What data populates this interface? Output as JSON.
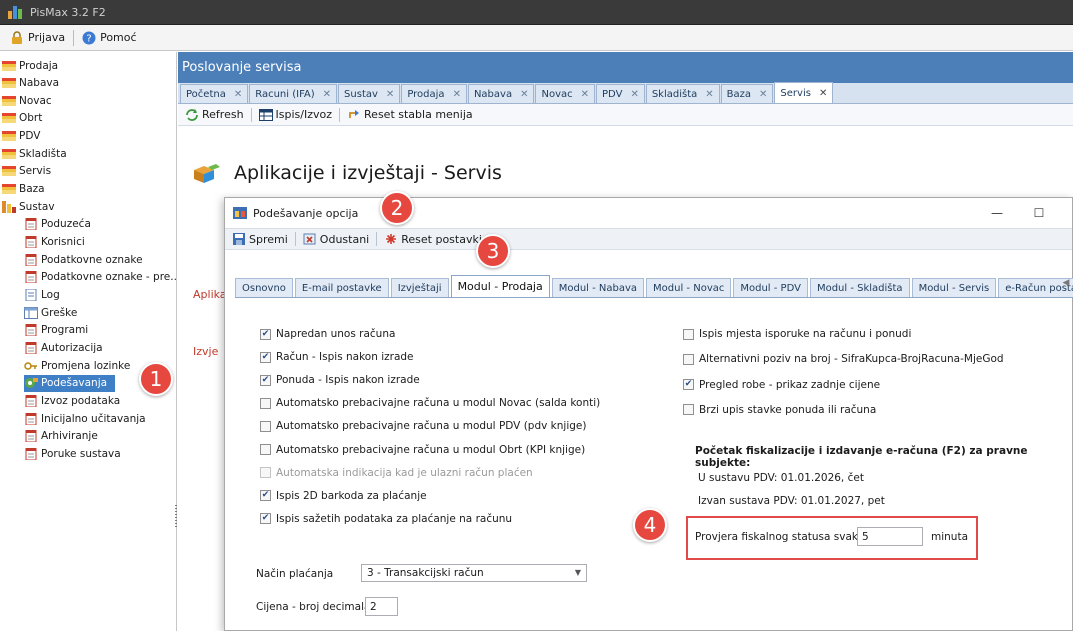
{
  "window": {
    "title": "PisMax 3.2 F2"
  },
  "menubar": {
    "items": [
      "Prijava",
      "Pomoć"
    ]
  },
  "tree": {
    "items": [
      {
        "label": "Prodaja",
        "level": 0,
        "icon": "folder-flag-icon"
      },
      {
        "label": "Nabava",
        "level": 0,
        "icon": "folder-flag-icon"
      },
      {
        "label": "Novac",
        "level": 0,
        "icon": "folder-flag-icon"
      },
      {
        "label": "Obrt",
        "level": 0,
        "icon": "folder-flag-icon"
      },
      {
        "label": "PDV",
        "level": 0,
        "icon": "folder-flag-icon"
      },
      {
        "label": "Skladišta",
        "level": 0,
        "icon": "folder-flag-icon"
      },
      {
        "label": "Servis",
        "level": 0,
        "icon": "folder-flag-icon"
      },
      {
        "label": "Baza",
        "level": 0,
        "icon": "folder-flag-icon"
      },
      {
        "label": "Sustav",
        "level": 0,
        "icon": "system-icon"
      },
      {
        "label": "Poduzeća",
        "level": 1,
        "icon": "document-icon"
      },
      {
        "label": "Korisnici",
        "level": 1,
        "icon": "document-icon"
      },
      {
        "label": "Podatkovne oznake",
        "level": 1,
        "icon": "document-icon"
      },
      {
        "label": "Podatkovne oznake - pre...",
        "level": 1,
        "icon": "document-icon"
      },
      {
        "label": "Log",
        "level": 1,
        "icon": "log-icon"
      },
      {
        "label": "Greške",
        "level": 1,
        "icon": "table-icon"
      },
      {
        "label": "Programi",
        "level": 1,
        "icon": "document-icon"
      },
      {
        "label": "Autorizacija",
        "level": 1,
        "icon": "document-icon"
      },
      {
        "label": "Promjena lozinke",
        "level": 1,
        "icon": "key-icon"
      },
      {
        "label": "Podešavanja",
        "level": 1,
        "icon": "settings-icon",
        "selected": true
      },
      {
        "label": "Izvoz podataka",
        "level": 1,
        "icon": "document-icon"
      },
      {
        "label": "Inicijalno učitavanja",
        "level": 1,
        "icon": "document-icon"
      },
      {
        "label": "Arhiviranje",
        "level": 1,
        "icon": "document-icon"
      },
      {
        "label": "Poruke sustava",
        "level": 1,
        "icon": "document-icon"
      }
    ]
  },
  "main": {
    "header": "Poslovanje servisa",
    "tabs": [
      "Početna",
      "Racuni (IFA)",
      "Sustav",
      "Prodaja",
      "Nabava",
      "Novac",
      "PDV",
      "Skladišta",
      "Baza",
      "Servis"
    ],
    "active_tab": "Servis",
    "toolbar": {
      "refresh": "Refresh",
      "print": "Ispis/Izvoz",
      "reset_tree": "Reset stabla menija"
    },
    "page_title": "Aplikacije i izvještaji - Servis",
    "bg_fragments": [
      "Aplika",
      "Izvje"
    ]
  },
  "dialog": {
    "title": "Podešavanje opcija",
    "toolbar": {
      "save": "Spremi",
      "cancel": "Odustani",
      "reset": "Reset postavki"
    },
    "tabs": [
      "Osnovno",
      "E-mail postavke",
      "Izvještaji",
      "Modul - Prodaja",
      "Modul - Nabava",
      "Modul - Novac",
      "Modul - PDV",
      "Modul - Skladišta",
      "Modul - Servis",
      "e-Račun postavke"
    ],
    "active_tab": "Modul - Prodaja",
    "left_options": [
      {
        "label": "Napredan unos računa",
        "checked": true,
        "enabled": true
      },
      {
        "label": "Račun - Ispis nakon izrade",
        "checked": true,
        "enabled": true
      },
      {
        "label": "Ponuda - Ispis nakon izrade",
        "checked": true,
        "enabled": true
      },
      {
        "label": "Automatsko prebacivajne računa u modul Novac (salda konti)",
        "checked": false,
        "enabled": true
      },
      {
        "label": "Automatsko prebacivajne računa u modul PDV (pdv knjige)",
        "checked": false,
        "enabled": true
      },
      {
        "label": "Automatsko prebacivajne računa u modul Obrt (KPI knjige)",
        "checked": false,
        "enabled": true
      },
      {
        "label": "Automatska indikacija kad je ulazni račun plaćen",
        "checked": false,
        "enabled": false
      },
      {
        "label": "Ispis 2D barkoda za plaćanje",
        "checked": true,
        "enabled": true
      },
      {
        "label": "Ispis sažetih podataka za plaćanje na računu",
        "checked": true,
        "enabled": true
      }
    ],
    "right_options": [
      {
        "label": "Ispis mjesta isporuke na računu i ponudi",
        "checked": false
      },
      {
        "label": "Alternativni poziv na broj - SifraKupca-BrojRacuna-MjeGod",
        "checked": false
      },
      {
        "label": "Pregled robe - prikaz zadnje cijene",
        "checked": true
      },
      {
        "label": "Brzi upis stavke ponuda ili računa",
        "checked": false
      }
    ],
    "fiscal": {
      "heading": "Početak fiskalizacije i izdavanje e-računa (F2) za pravne subjekte:",
      "in_vat": "U sustavu PDV: 01.01.2026, čet",
      "out_vat": "Izvan sustava PDV: 01.01.2027, pet",
      "check_label": "Provjera fiskalnog statusa svakih",
      "check_value": "5",
      "check_unit": "minuta"
    },
    "payment": {
      "label": "Način plaćanja",
      "value": "3 - Transakcijski račun"
    },
    "decimals": {
      "label": "Cijena - broj decimala",
      "value": "2"
    }
  },
  "annotations": [
    "1",
    "2",
    "3",
    "4"
  ],
  "colors": {
    "accent": "#4c7fb8",
    "selection": "#3f7fc5",
    "badge": "#e6483f"
  }
}
